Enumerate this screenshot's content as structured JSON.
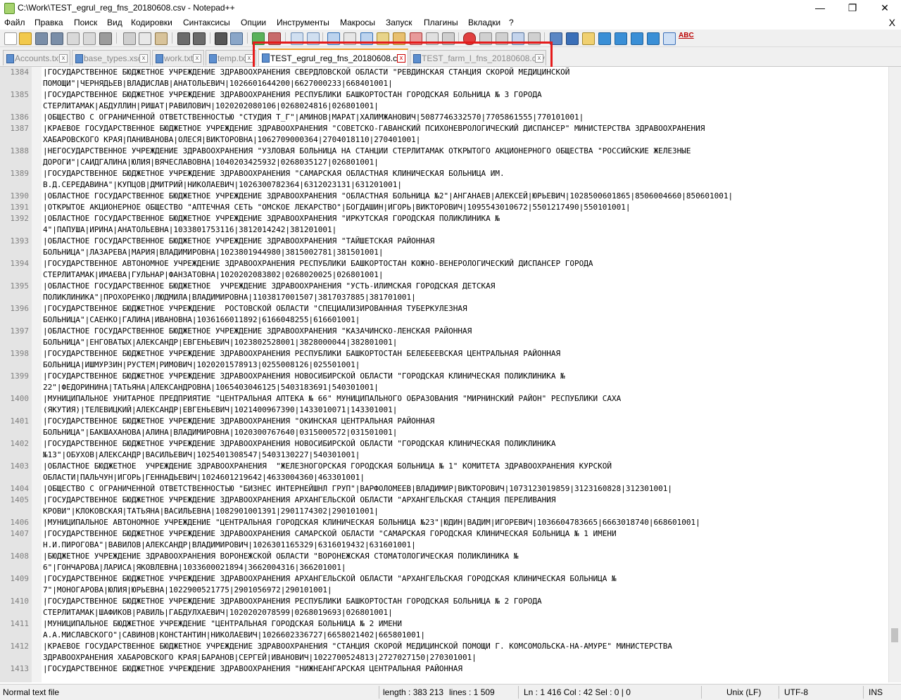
{
  "window": {
    "title": "C:\\Work\\TEST_egrul_reg_fns_20180608.csv - Notepad++",
    "minimize": "—",
    "maximize": "❐",
    "close": "✕"
  },
  "menu": {
    "items": [
      "Файл",
      "Правка",
      "Поиск",
      "Вид",
      "Кодировки",
      "Синтаксисы",
      "Опции",
      "Инструменты",
      "Макросы",
      "Запуск",
      "Плагины",
      "Вкладки",
      "?"
    ],
    "close": "X"
  },
  "toolbar": {
    "spellcheck_label": "ABC"
  },
  "tabs": [
    {
      "label": "Accounts.txt",
      "close": "x"
    },
    {
      "label": "base_types.xsd",
      "close": "x"
    },
    {
      "label": "work.txt",
      "close": "x"
    },
    {
      "label": "temp.txt",
      "close": "x"
    },
    {
      "label": "TEST_egrul_reg_fns_20180608.csv",
      "close": "x",
      "active": true
    },
    {
      "label": "TEST_farm_l_fns_20180608.csv",
      "close": "x"
    }
  ],
  "editor": {
    "rows": [
      {
        "ln": "1384",
        "text": "|ГОСУДАРСТВЕННОЕ БЮДЖЕТНОЕ УЧРЕЖДЕНИЕ ЗДРАВООХРАНЕНИЯ СВЕРДЛОВСКОЙ ОБЛАСТИ \"РЕВДИНСКАЯ СТАНЦИЯ СКОРОЙ МЕДИЦИНСКОЙ"
      },
      {
        "ln": "",
        "text": "ПОМОЩИ\"|ЧЕРНЯДЬЕВ|ВЛАДИСЛАВ|АНАТОЛЬЕВИЧ|1026601644200|6627000233|668401001|"
      },
      {
        "ln": "1385",
        "text": "|ГОСУДАРСТВЕННОЕ БЮДЖЕТНОЕ УЧРЕЖДЕНИЕ ЗДРАВООХРАНЕНИЯ РЕСПУБЛИКИ БАШКОРТОСТАН ГОРОДСКАЯ БОЛЬНИЦА № 3 ГОРОДА"
      },
      {
        "ln": "",
        "text": "СТЕРЛИТАМАК|АБДУЛЛИН|РИШАТ|РАВИЛОВИЧ|1020202080106|0268024816|026801001|"
      },
      {
        "ln": "1386",
        "text": "|ОБЩЕСТВО С ОГРАНИЧЕННОЙ ОТВЕТСТВЕННОСТЬЮ \"СТУДИЯ Т_Г\"|АМИНОВ|МАРАТ|ХАЛИМЖАНОВИЧ|5087746332570|7705861555|770101001|"
      },
      {
        "ln": "1387",
        "text": "|КРАЕВОЕ ГОСУДАРСТВЕННОЕ БЮДЖЕТНОЕ УЧРЕЖДЕНИЕ ЗДРАВООХРАНЕНИЯ \"СОВЕТСКО-ГАВАНСКИЙ ПСИХОНЕВРОЛОГИЧЕСКИЙ ДИСПАНСЕР\" МИНИСТЕРСТВА ЗДРАВООХРАНЕНИЯ"
      },
      {
        "ln": "",
        "text": "ХАБАРОВСКОГО КРАЯ|ПАНИВАНОВА|ОЛЕСЯ|ВИКТОРОВНА|1062709000364|2704018110|270401001|"
      },
      {
        "ln": "1388",
        "text": "|НЕГОСУДАРСТВЕННОЕ УЧРЕЖДЕНИЕ ЗДРАВООХРАНЕНИЯ \"УЗЛОВАЯ БОЛЬНИЦА НА СТАНЦИИ СТЕРЛИТАМАК ОТКРЫТОГО АКЦИОНЕРНОГО ОБЩЕСТВА \"РОССИЙСКИЕ ЖЕЛЕЗНЫЕ"
      },
      {
        "ln": "",
        "text": "ДОРОГИ\"|САИДГАЛИНА|ЮЛИЯ|ВЯЧЕСЛАВОВНА|1040203425932|0268035127|026801001|"
      },
      {
        "ln": "1389",
        "text": "|ГОСУДАРСТВЕННОЕ БЮДЖЕТНОЕ УЧРЕЖДЕНИЕ ЗДРАВООХРАНЕНИЯ \"САМАРСКАЯ ОБЛАСТНАЯ КЛИНИЧЕСКАЯ БОЛЬНИЦА ИМ."
      },
      {
        "ln": "",
        "text": "В.Д.СЕРЕДАВИНА\"|КУПЦОВ|ДМИТРИЙ|НИКОЛАЕВИЧ|1026300782364|6312023131|631201001|"
      },
      {
        "ln": "1390",
        "text": "|ОБЛАСТНОЕ ГОСУДАРСТВЕННОЕ БЮДЖЕТНОЕ УЧРЕЖДЕНИЕ ЗДРАВООХРАНЕНИЯ \"ОБЛАСТНАЯ БОЛЬНИЦА №2\"|АНГАНАЕВ|АЛЕКСЕЙ|ЮРЬЕВИЧ|1028500601865|8506004660|850601001|"
      },
      {
        "ln": "1391",
        "text": "|ОТКРЫТОЕ АКЦИОНЕРНОЕ ОБЩЕСТВО \"АПТЕЧНАЯ СЕТЬ \"ОМСКОЕ ЛЕКАРСТВО\"|БОГДАШИН|ИГОРЬ|ВИКТОРОВИЧ|1095543010672|5501217490|550101001|"
      },
      {
        "ln": "1392",
        "text": "|ОБЛАСТНОЕ ГОСУДАРСТВЕННОЕ БЮДЖЕТНОЕ УЧРЕЖДЕНИЕ ЗДРАВООХРАНЕНИЯ \"ИРКУТСКАЯ ГОРОДСКАЯ ПОЛИКЛИНИКА №"
      },
      {
        "ln": "",
        "text": "4\"|ПАПУША|ИРИНА|АНАТОЛЬЕВНА|1033801753116|3812014242|381201001|"
      },
      {
        "ln": "1393",
        "text": "|ОБЛАСТНОЕ ГОСУДАРСТВЕННОЕ БЮДЖЕТНОЕ УЧРЕЖДЕНИЕ ЗДРАВООХРАНЕНИЯ \"ТАЙШЕТСКАЯ РАЙОННАЯ"
      },
      {
        "ln": "",
        "text": "БОЛЬНИЦА\"|ЛАЗАРЕВА|МАРИЯ|ВЛАДИМИРОВНА|1023801944980|3815002781|381501001|"
      },
      {
        "ln": "1394",
        "text": "|ГОСУДАРСТВЕННОЕ АВТОНОМНОЕ УЧРЕЖДЕНИЕ ЗДРАВООХРАНЕНИЯ РЕСПУБЛИКИ БАШКОРТОСТАН КОЖНО-ВЕНЕРОЛОГИЧЕСКИЙ ДИСПАНСЕР ГОРОДА"
      },
      {
        "ln": "",
        "text": "СТЕРЛИТАМАК|ИМАЕВА|ГУЛЬНАР|ФАНЗАТОВНА|1020202083802|0268020025|026801001|"
      },
      {
        "ln": "1395",
        "text": "|ОБЛАСТНОЕ ГОСУДАРСТВЕННОЕ БЮДЖЕТНОЕ  УЧРЕЖДЕНИЕ ЗДРАВООХРАНЕНИЯ \"УСТЬ-ИЛИМСКАЯ ГОРОДСКАЯ ДЕТСКАЯ"
      },
      {
        "ln": "",
        "text": "ПОЛИКЛИНИКА\"|ПРОХОРЕНКО|ЛЮДМИЛА|ВЛАДИМИРОВНА|1103817001507|3817037885|381701001|"
      },
      {
        "ln": "1396",
        "text": "|ГОСУДАРСТВЕННОЕ БЮДЖЕТНОЕ УЧРЕЖДЕНИЕ  РОСТОВСКОЙ ОБЛАСТИ \"СПЕЦИАЛИЗИРОВАННАЯ ТУБЕРКУЛЕЗНАЯ"
      },
      {
        "ln": "",
        "text": "БОЛЬНИЦА\"|САЕНКО|ГАЛИНА|ИВАНОВНА|1036166011892|6166048255|616601001|"
      },
      {
        "ln": "1397",
        "text": "|ОБЛАСТНОЕ ГОСУДАРСТВЕННОЕ БЮДЖЕТНОЕ УЧРЕЖДЕНИЕ ЗДРАВООХРАНЕНИЯ \"КАЗАЧИНСКО-ЛЕНСКАЯ РАЙОННАЯ"
      },
      {
        "ln": "",
        "text": "БОЛЬНИЦА\"|ЕНГОВАТЫХ|АЛЕКСАНДР|ЕВГЕНЬЕВИЧ|1023802528001|3828000044|382801001|"
      },
      {
        "ln": "1398",
        "text": "|ГОСУДАРСТВЕННОЕ БЮДЖЕТНОЕ УЧРЕЖДЕНИЕ ЗДРАВООХРАНЕНИЯ РЕСПУБЛИКИ БАШКОРТОСТАН БЕЛЕБЕЕВСКАЯ ЦЕНТРАЛЬНАЯ РАЙОННАЯ"
      },
      {
        "ln": "",
        "text": "БОЛЬНИЦА|ИШМУРЗИН|РУСТЕМ|РИМОВИЧ|1020201578913|0255008126|025501001|"
      },
      {
        "ln": "1399",
        "text": "|ГОСУДАРСТВЕННОЕ БЮДЖЕТНОЕ УЧРЕЖДЕНИЕ ЗДРАВООХРАНЕНИЯ НОВОСИБИРСКОЙ ОБЛАСТИ \"ГОРОДСКАЯ КЛИНИЧЕСКАЯ ПОЛИКЛИНИКА №"
      },
      {
        "ln": "",
        "text": "22\"|ФЕДОРИНИНА|ТАТЬЯНА|АЛЕКСАНДРОВНА|1065403046125|5403183691|540301001|"
      },
      {
        "ln": "1400",
        "text": "|МУНИЦИПАЛЬНОЕ УНИТАРНОЕ ПРЕДПРИЯТИЕ \"ЦЕНТРАЛЬНАЯ АПТЕКА № 66\" МУНИЦИПАЛЬНОГО ОБРАЗОВАНИЯ \"МИРНИНСКИЙ РАЙОН\" РЕСПУБЛИКИ САХА"
      },
      {
        "ln": "",
        "text": "(ЯКУТИЯ)|ТЕЛЕВИЦКИЙ|АЛЕКСАНДР|ЕВГЕНЬЕВИЧ|1021400967390|1433010071|143301001|"
      },
      {
        "ln": "1401",
        "text": "|ГОСУДАРСТВЕННОЕ БЮДЖЕТНОЕ УЧРЕЖДЕНИЕ ЗДРАВООХРАНЕНИЯ \"ОКИНСКАЯ ЦЕНТРАЛЬНАЯ РАЙОННАЯ"
      },
      {
        "ln": "",
        "text": "БОЛЬНИЦА\"|БАКШАХАНОВА|АЛИНА|ВЛАДИМИРОВНА|1020300767640|0315000572|031501001|"
      },
      {
        "ln": "1402",
        "text": "|ГОСУДАРСТВЕННОЕ БЮДЖЕТНОЕ УЧРЕЖДЕНИЕ ЗДРАВООХРАНЕНИЯ НОВОСИБИРСКОЙ ОБЛАСТИ \"ГОРОДСКАЯ КЛИНИЧЕСКАЯ ПОЛИКЛИНИКА"
      },
      {
        "ln": "",
        "text": "№13\"|ОБУХОВ|АЛЕКСАНДР|ВАСИЛЬЕВИЧ|1025401308547|5403130227|540301001|"
      },
      {
        "ln": "1403",
        "text": "|ОБЛАСТНОЕ БЮДЖЕТНОЕ  УЧРЕЖДЕНИЕ ЗДРАВООХРАНЕНИЯ  \"ЖЕЛЕЗНОГОРСКАЯ ГОРОДСКАЯ БОЛЬНИЦА № 1\" КОМИТЕТА ЗДРАВООХРАНЕНИЯ КУРСКОЙ"
      },
      {
        "ln": "",
        "text": "ОБЛАСТИ|ПАЛЬЧУН|ИГОРЬ|ГЕННАДЬЕВИЧ|1024601219642|4633004360|463301001|"
      },
      {
        "ln": "1404",
        "text": "|ОБЩЕСТВО С ОГРАНИЧЕННОЙ ОТВЕТСТВЕННОСТЬЮ \"БИЗНЕС ИНТЕРНЕЙШНЛ ГРУП\"|ВАРФОЛОМЕЕВ|ВЛАДИМИР|ВИКТОРОВИЧ|1073123019859|3123160828|312301001|"
      },
      {
        "ln": "1405",
        "text": "|ГОСУДАРСТВЕННОЕ БЮДЖЕТНОЕ УЧРЕЖДЕНИЕ ЗДРАВООХРАНЕНИЯ АРХАНГЕЛЬСКОЙ ОБЛАСТИ \"АРХАНГЕЛЬСКАЯ СТАНЦИЯ ПЕРЕЛИВАНИЯ"
      },
      {
        "ln": "",
        "text": "КРОВИ\"|КЛОКОВСКАЯ|ТАТЬЯНА|ВАСИЛЬЕВНА|1082901001391|2901174302|290101001|"
      },
      {
        "ln": "1406",
        "text": "|МУНИЦИПАЛЬНОЕ АВТОНОМНОЕ УЧРЕЖДЕНИЕ \"ЦЕНТРАЛЬНАЯ ГОРОДСКАЯ КЛИНИЧЕСКАЯ БОЛЬНИЦА №23\"|ЮДИН|ВАДИМ|ИГОРЕВИЧ|1036604783665|6663018740|668601001|"
      },
      {
        "ln": "1407",
        "text": "|ГОСУДАРСТВЕННОЕ БЮДЖЕТНОЕ УЧРЕЖДЕНИЕ ЗДРАВООХРАНЕНИЯ САМАРСКОЙ ОБЛАСТИ \"САМАРСКАЯ ГОРОДСКАЯ КЛИНИЧЕСКАЯ БОЛЬНИЦА № 1 ИМЕНИ"
      },
      {
        "ln": "",
        "text": "Н.И.ПИРОГОВА\"|ВАВИЛОВ|АЛЕКСАНДР|ВЛАДИМИРОВИЧ|1026301165329|6316019432|631601001|"
      },
      {
        "ln": "1408",
        "text": "|БЮДЖЕТНОЕ УЧРЕЖДЕНИЕ ЗДРАВООХРАНЕНИЯ ВОРОНЕЖСКОЙ ОБЛАСТИ \"ВОРОНЕЖСКАЯ СТОМАТОЛОГИЧЕСКАЯ ПОЛИКЛИНИКА №"
      },
      {
        "ln": "",
        "text": "6\"|ГОНЧАРОВА|ЛАРИСА|ЯКОВЛЕВНА|1033600021894|3662004316|366201001|"
      },
      {
        "ln": "1409",
        "text": "|ГОСУДАРСТВЕННОЕ БЮДЖЕТНОЕ УЧРЕЖДЕНИЕ ЗДРАВООХРАНЕНИЯ АРХАНГЕЛЬСКОЙ ОБЛАСТИ \"АРХАНГЕЛЬСКАЯ ГОРОДСКАЯ КЛИНИЧЕСКАЯ БОЛЬНИЦА №"
      },
      {
        "ln": "",
        "text": "7\"|МОНОГАРОВА|ЮЛИЯ|ЮРЬЕВНА|1022900521775|2901056972|290101001|"
      },
      {
        "ln": "1410",
        "text": "|ГОСУДАРСТВЕННОЕ БЮДЖЕТНОЕ УЧРЕЖДЕНИЕ ЗДРАВООХРАНЕНИЯ РЕСПУБЛИКИ БАШКОРТОСТАН ГОРОДСКАЯ БОЛЬНИЦА № 2 ГОРОДА"
      },
      {
        "ln": "",
        "text": "СТЕРЛИТАМАК|ШАФИКОВ|РАВИЛЬ|ГАБДУЛХАЕВИЧ|1020202078599|0268019693|026801001|"
      },
      {
        "ln": "1411",
        "text": "|МУНИЦИПАЛЬНОЕ БЮДЖЕТНОЕ УЧРЕЖДЕНИЕ \"ЦЕНТРАЛЬНАЯ ГОРОДСКАЯ БОЛЬНИЦА № 2 ИМЕНИ"
      },
      {
        "ln": "",
        "text": "А.А.МИСЛАВСКОГО\"|САВИНОВ|КОНСТАНТИН|НИКОЛАЕВИЧ|1026602336727|6658021402|665801001|"
      },
      {
        "ln": "1412",
        "text": "|КРАЕВОЕ ГОСУДАРСТВЕННОЕ БЮДЖЕТНОЕ УЧРЕЖДЕНИЕ ЗДРАВООХРАНЕНИЯ \"СТАНЦИЯ СКОРОЙ МЕДИЦИНСКОЙ ПОМОЩИ Г. КОМСОМОЛЬСКА-НА-АМУРЕ\" МИНИСТЕРСТВА"
      },
      {
        "ln": "",
        "text": "ЗДРАВООХРАНЕНИЯ ХАБАРОВСКОГО КРАЯ|БАРАНОВ|СЕРГЕЙ|ИВАНОВИЧ|1022700524813|2727027150|270301001|"
      },
      {
        "ln": "1413",
        "text": "|ГОСУДАРСТВЕННОЕ БЮДЖЕТНОЕ УЧРЕЖДЕНИЕ ЗДРАВООХРАНЕНИЯ \"НИЖНЕАНГАРСКАЯ ЦЕНТРАЛЬНАЯ РАЙОННАЯ"
      }
    ]
  },
  "status": {
    "language": "Normal text file",
    "length": "length : 383 213",
    "lines": "lines : 1 509",
    "position": "Ln : 1 416    Col : 42    Sel : 0 | 0",
    "eol": "Unix (LF)",
    "encoding": "UTF-8",
    "mode": "INS"
  },
  "colors": {
    "highlight_box": "#e51a1a",
    "active_tab_accent": "#f0a030"
  }
}
